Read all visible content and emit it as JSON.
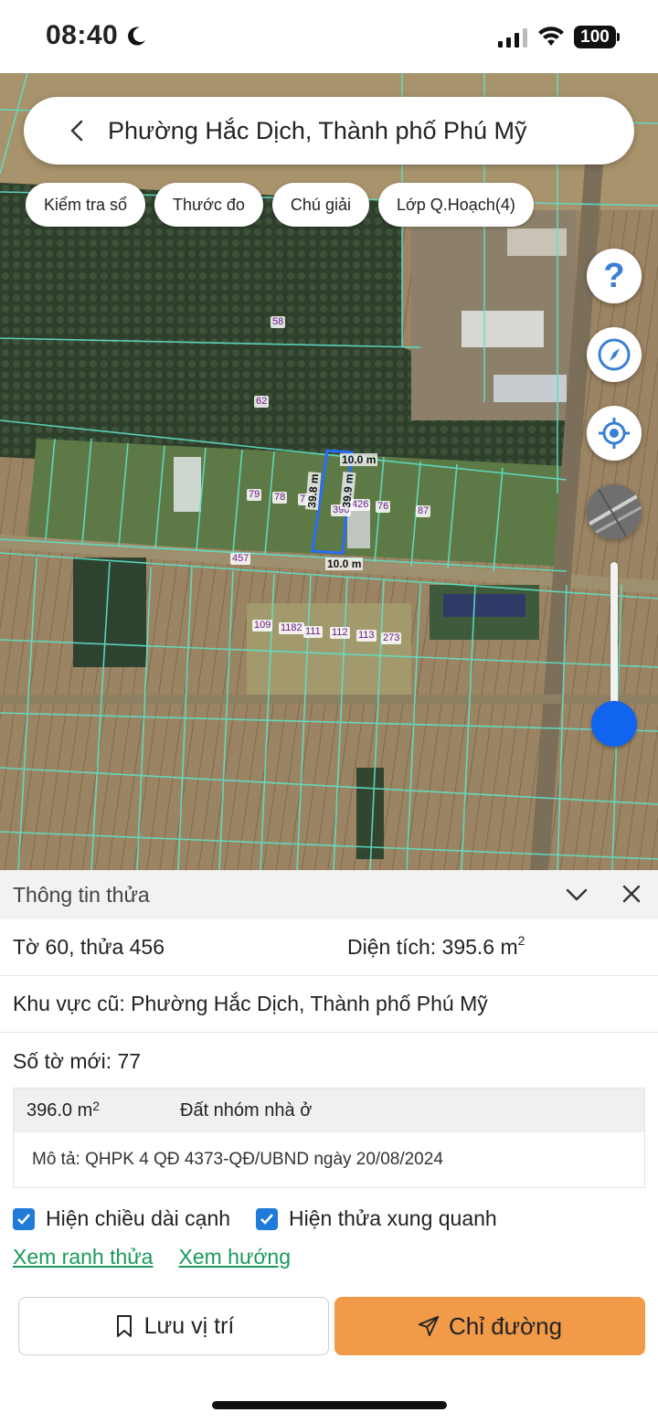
{
  "status_bar": {
    "time": "08:40",
    "battery": "100"
  },
  "search": {
    "title": "Phường Hắc Dịch, Thành phố Phú Mỹ"
  },
  "chips": [
    {
      "label": "Kiểm tra sổ"
    },
    {
      "label": "Thước đo"
    },
    {
      "label": "Chú giải"
    },
    {
      "label": "Lớp Q.Hoạch(4)"
    }
  ],
  "map": {
    "help_symbol": "?",
    "parcel_labels": [
      "58",
      "62",
      "79",
      "78",
      "77",
      "396",
      "426",
      "76",
      "87",
      "457",
      "109",
      "1182",
      "111",
      "112",
      "113",
      "273"
    ],
    "dimension_labels": {
      "top": "10.0 m",
      "bottom": "10.0 m",
      "left": "39.8 m",
      "right": "39.9 m"
    }
  },
  "panel": {
    "title": "Thông tin thửa",
    "sheet_parcel": "Tờ 60, thửa 456",
    "area_label": "Diện tích: 395.6 m",
    "area_unit_sup": "2",
    "old_area": "Khu vực cũ: Phường Hắc Dịch, Thành phố Phú Mỹ",
    "new_sheet": "Số tờ mới: 77",
    "land": {
      "area": "396.0 m",
      "area_sup": "2",
      "type": "Đất nhóm nhà ở",
      "description": "Mô tả: QHPK 4 QĐ 4373-QĐ/UBND ngày 20/08/2024"
    },
    "checkboxes": [
      {
        "label": "Hiện chiều dài cạnh",
        "checked": true
      },
      {
        "label": "Hiện thửa xung quanh",
        "checked": true
      }
    ],
    "links": [
      "Xem ranh thửa",
      "Xem hướng"
    ],
    "buttons": {
      "save": "Lưu vị trí",
      "directions": "Chỉ đường"
    }
  },
  "colors": {
    "accent_blue": "#1164f0",
    "checkbox_blue": "#1f7ad8",
    "link_green": "#1a9a5a",
    "directions_orange": "#f19a48",
    "parcel_line": "#5fe0c8",
    "selected_parcel": "#2a6cf5"
  }
}
